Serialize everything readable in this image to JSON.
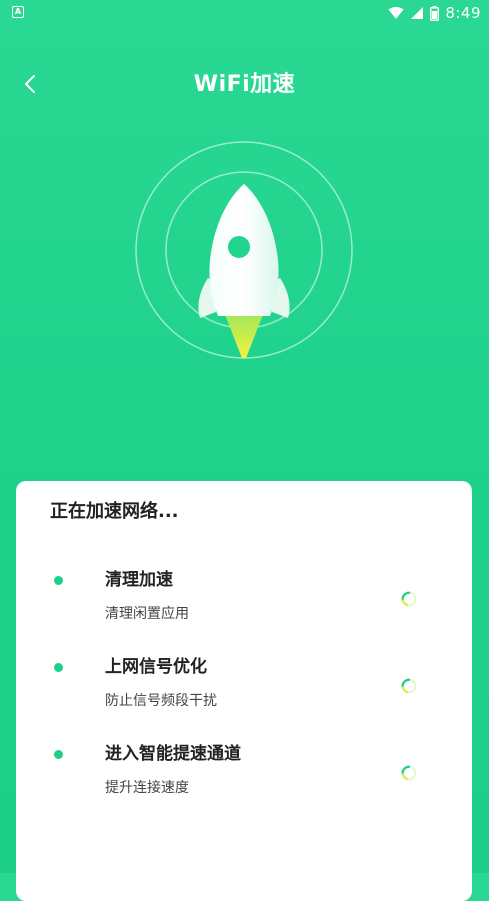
{
  "status_bar": {
    "app_icon_letter": "A",
    "time": "8:49",
    "icons": [
      "wifi-icon",
      "cell-signal-icon",
      "battery-icon"
    ]
  },
  "header": {
    "back_icon": "chevron-left-icon",
    "title": "WiFi加速"
  },
  "hero": {
    "icon": "rocket-icon"
  },
  "card": {
    "title": "正在加速网络...",
    "tasks": [
      {
        "title": "清理加速",
        "subtitle": "清理闲置应用",
        "status_icon": "loading-spinner-icon"
      },
      {
        "title": "上网信号优化",
        "subtitle": "防止信号频段干扰",
        "status_icon": "loading-spinner-icon"
      },
      {
        "title": "进入智能提速通道",
        "subtitle": "提升连接速度",
        "status_icon": "loading-spinner-icon"
      }
    ]
  },
  "colors": {
    "background": "#22d48d",
    "accent": "#1fce89",
    "card": "#ffffff",
    "flame": "#e3f04a"
  }
}
